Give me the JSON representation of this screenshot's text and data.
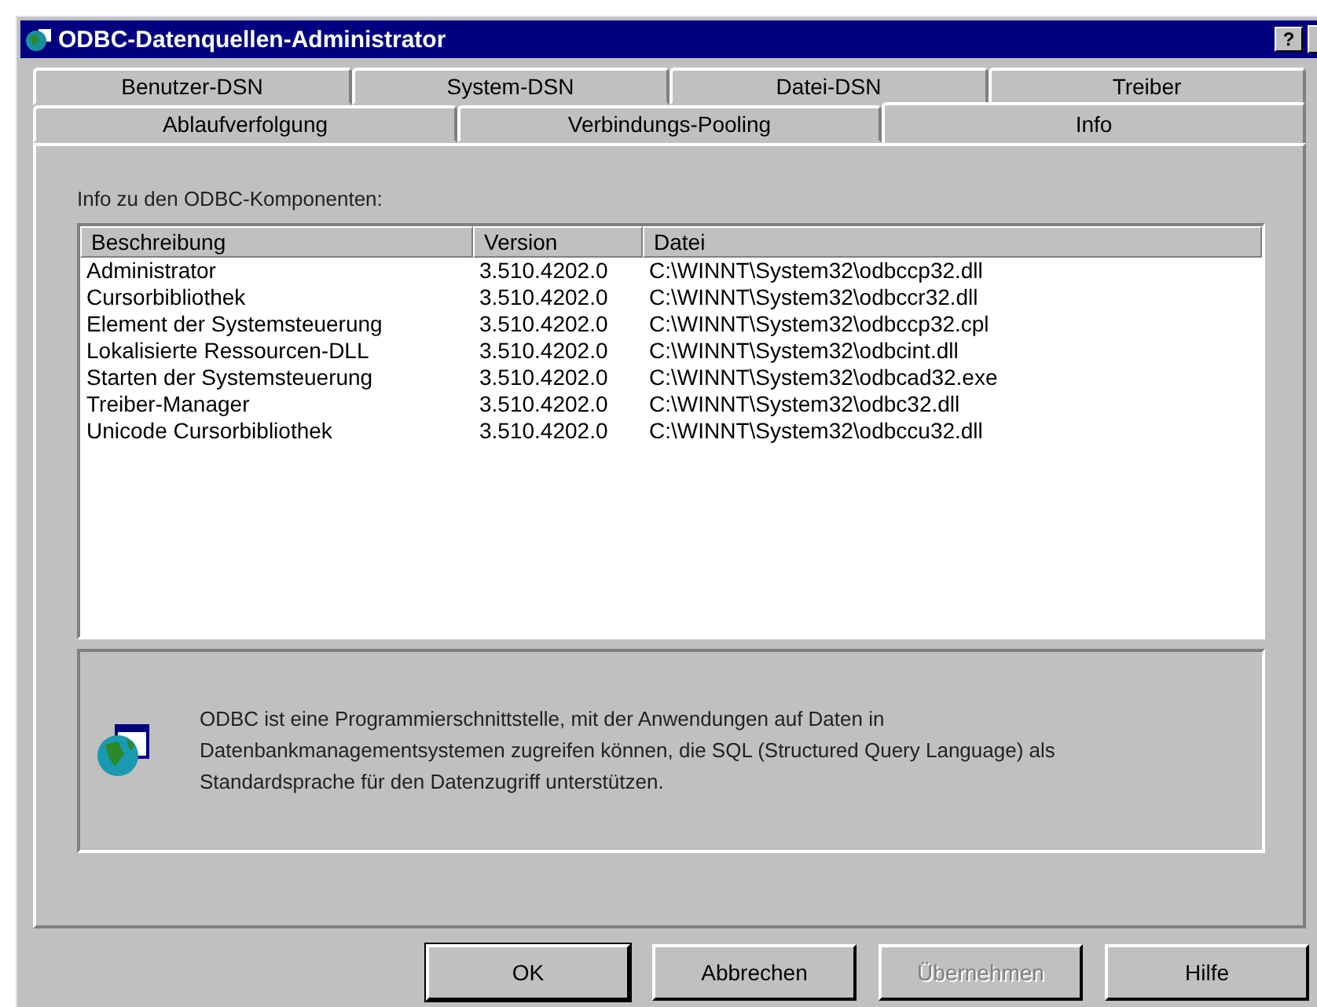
{
  "window": {
    "title": "ODBC-Datenquellen-Administrator",
    "help_button": "?"
  },
  "tab_rows": [
    {
      "tabs": [
        {
          "label": "Benutzer-DSN",
          "selected": false
        },
        {
          "label": "System-DSN",
          "selected": false
        },
        {
          "label": "Datei-DSN",
          "selected": false
        },
        {
          "label": "Treiber",
          "selected": false
        }
      ]
    },
    {
      "tabs": [
        {
          "label": "Ablaufverfolgung",
          "selected": false
        },
        {
          "label": "Verbindungs-Pooling",
          "selected": false
        },
        {
          "label": "Info",
          "selected": true
        }
      ]
    }
  ],
  "section_label": "Info zu den ODBC-Komponenten:",
  "table": {
    "columns": [
      "Beschreibung",
      "Version",
      "Datei"
    ],
    "rows": [
      [
        "Administrator",
        "3.510.4202.0",
        "C:\\WINNT\\System32\\odbccp32.dll"
      ],
      [
        "Cursorbibliothek",
        "3.510.4202.0",
        "C:\\WINNT\\System32\\odbccr32.dll"
      ],
      [
        "Element der Systemsteuerung",
        "3.510.4202.0",
        "C:\\WINNT\\System32\\odbccp32.cpl"
      ],
      [
        "Lokalisierte Ressourcen-DLL",
        "3.510.4202.0",
        "C:\\WINNT\\System32\\odbcint.dll"
      ],
      [
        "Starten der Systemsteuerung",
        "3.510.4202.0",
        "C:\\WINNT\\System32\\odbcad32.exe"
      ],
      [
        "Treiber-Manager",
        "3.510.4202.0",
        "C:\\WINNT\\System32\\odbc32.dll"
      ],
      [
        "Unicode Cursorbibliothek",
        "3.510.4202.0",
        "C:\\WINNT\\System32\\odbccu32.dll"
      ]
    ]
  },
  "description": "ODBC ist eine Programmierschnittstelle, mit der Anwendungen auf Daten in Datenbankmanagementsystemen zugreifen können, die SQL (Structured Query Language) als Standardsprache für den Datenzugriff unterstützen.",
  "buttons": [
    {
      "label": "OK",
      "disabled": false,
      "default": true
    },
    {
      "label": "Abbrechen",
      "disabled": false,
      "default": false
    },
    {
      "label": "Übernehmen",
      "disabled": true,
      "default": false
    },
    {
      "label": "Hilfe",
      "disabled": false,
      "default": false
    }
  ]
}
